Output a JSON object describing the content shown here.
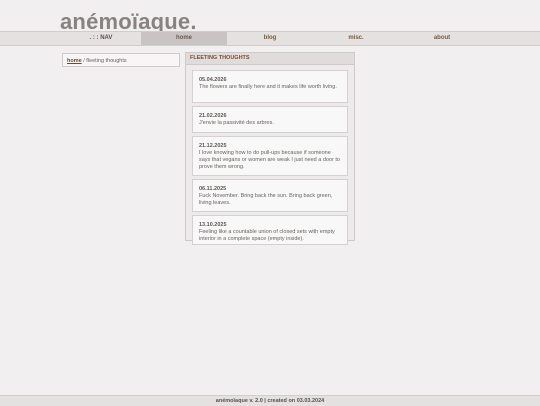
{
  "site": {
    "title": "anémoïaque."
  },
  "nav": {
    "label": ". : : NAV",
    "items": [
      {
        "label": "home",
        "active": true
      },
      {
        "label": "blog",
        "active": false
      },
      {
        "label": "misc.",
        "active": false
      },
      {
        "label": "about",
        "active": false
      }
    ]
  },
  "breadcrumb": {
    "home": "home",
    "separator": " / ",
    "current": "fleeting thoughts"
  },
  "panel": {
    "title": "FLEETING THOUGHTS",
    "entries": [
      {
        "date": "05.04.2026",
        "text": "The flowers are finally here and it makes life worth living."
      },
      {
        "date": "21.02.2026",
        "text": "J'envie la passivité des arbres."
      },
      {
        "date": "21.12.2025",
        "text": "I love knowing how to do pull-ups because if someone says that vegans or women are weak I just need a door to prove them wrong."
      },
      {
        "date": "06.11.2025",
        "text": "Fuck November. Bring back the sun. Bring back green, living leaves."
      },
      {
        "date": "13.10.2025",
        "text": "Feeling like a countable union of closed sets with empty interior in a complete space (empty inside)."
      }
    ]
  },
  "footer": {
    "text": "anémoïaque v. 2.0 | created on 03.03.2024"
  },
  "colors": {
    "background": "#f1efef",
    "nav_active": "#c9c3c3",
    "link": "#7b5a3e",
    "panel_header_text": "#7b4e32"
  }
}
